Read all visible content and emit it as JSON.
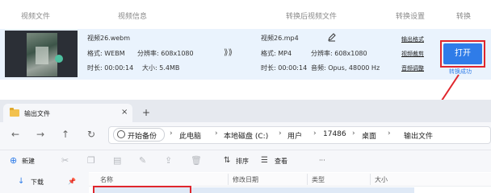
{
  "converter": {
    "headers": [
      "视频文件",
      "视频信息",
      "转换后视频文件",
      "转换设置",
      "转换"
    ],
    "source": {
      "filename": "视频26.webm",
      "format": "格式: WEBM",
      "resolution": "分辨率: 608x1080",
      "duration": "时长: 00:00:14",
      "size": "大小: 5.4MB"
    },
    "arrow": "⟫⟫",
    "output": {
      "filename": "视频26.mp4",
      "format": "格式: MP4",
      "resolution": "分辨率: 608x1080",
      "duration": "时长: 00:00:14",
      "audio": "音频: Opus, 48000 Hz"
    },
    "settings_links": [
      "输出格式",
      "视频裁剪",
      "音频调整"
    ],
    "open_label": "打开",
    "status": "转换成功",
    "accent": "#2f7ce8",
    "highlight": "#e0262c"
  },
  "explorer": {
    "tab_title": "输出文件",
    "tab_close": "×",
    "tab_add": "+",
    "nav": [
      "←",
      "→",
      "↑",
      "↻"
    ],
    "breadcrumb": [
      "开始备份",
      "此电脑",
      "本地磁盘 (C:)",
      "用户",
      "17486",
      "桌面",
      "输出文件"
    ],
    "crumb_sep": "›",
    "toolbar": {
      "new_label": "新建",
      "sort_label": "排序",
      "view_label": "查看",
      "more": "···"
    },
    "columns": [
      "名称",
      "修改日期",
      "类型",
      "大小"
    ],
    "sidebar_item": "下载"
  }
}
